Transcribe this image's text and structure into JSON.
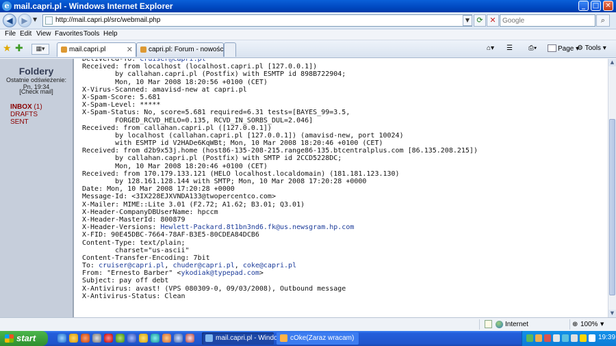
{
  "window": {
    "title": "mail.capri.pl - Windows Internet Explorer",
    "minimize": "_",
    "maximize": "□",
    "close": "✕"
  },
  "address_bar": {
    "url": "http://mail.capri.pl/src/webmail.php",
    "search_placeholder": "Google"
  },
  "menu": [
    "File",
    "Edit",
    "View",
    "Favorites",
    "Tools",
    "Help"
  ],
  "tabs": [
    {
      "label": "mail.capri.pl",
      "active": true
    },
    {
      "label": "capri.pl: Forum - nowości",
      "active": false
    }
  ],
  "command_bar": {
    "page": "Page",
    "tools": "Tools"
  },
  "sidebar": {
    "heading": "Foldery",
    "last_refresh_label": "Ostatnie odświeżenie:",
    "last_refresh_time": "Pn, 19:34",
    "check_mail": "[Check mail]",
    "folders": [
      {
        "name": "INBOX",
        "count": "(1)"
      },
      {
        "name": "DRAFTS",
        "count": ""
      },
      {
        "name": "SENT",
        "count": ""
      }
    ]
  },
  "headers": [
    {
      "text": "Delivered-To: ",
      "link": "cruiser@capri.pl",
      "tail": ""
    },
    {
      "text": "Received: from localhost (localhost.capri.pl [127.0.0.1])"
    },
    {
      "text": "        by callahan.capri.pl (Postfix) with ESMTP id 898B722904;"
    },
    {
      "text": "        Mon, 10 Mar 2008 18:20:56 +0100 (CET)"
    },
    {
      "text": "X-Virus-Scanned: amavisd-new at capri.pl"
    },
    {
      "text": "X-Spam-Score: 5.681"
    },
    {
      "text": "X-Spam-Level: *****"
    },
    {
      "text": "X-Spam-Status: No, score=5.681 required=6.31 tests=[BAYES_99=3.5,"
    },
    {
      "text": "        FORGED_RCVD_HELO=0.135, RCVD_IN_SORBS_DUL=2.046]"
    },
    {
      "text": "Received: from callahan.capri.pl ([127.0.0.1])"
    },
    {
      "text": "        by localhost (callahan.capri.pl [127.0.0.1]) (amavisd-new, port 10024)"
    },
    {
      "text": "        with ESMTP id V2HADe6KqWBt; Mon, 10 Mar 2008 18:20:46 +0100 (CET)"
    },
    {
      "text": "Received: from d2b9x53j.home (host86-135-208-215.range86-135.btcentralplus.com [86.135.208.215])"
    },
    {
      "text": "        by callahan.capri.pl (Postfix) with SMTP id 2CCD5228DC;"
    },
    {
      "text": "        Mon, 10 Mar 2008 18:20:46 +0100 (CET)"
    },
    {
      "text": "Received: from 170.179.133.121 (HELO localhost.localdomain) (181.181.123.130)"
    },
    {
      "text": "        by 128.161.128.144 with SMTP; Mon, 10 Mar 2008 17:20:28 +0000"
    },
    {
      "text": "Date: Mon, 10 Mar 2008 17:20:28 +0000"
    },
    {
      "text": "Message-Id: <3IX228EJXVNDA133@twopercentco.com>"
    },
    {
      "text": "X-Mailer: MIME::Lite 3.01 (F2.72; A1.62; B3.01; Q3.01)"
    },
    {
      "text": "X-Header-CompanyDBUserName: hpccm"
    },
    {
      "text": "X-Header-MasterId: 800879"
    },
    {
      "text": "X-Header-Versions: ",
      "link": "Hewlett-Packard.8t1bn3nd6.fk@us.newsgram.hp.com",
      "tail": ""
    },
    {
      "text": "X-FID: 90E45DBC-7664-78AF-B3E5-80CDEA84DCB6"
    },
    {
      "text": "Content-Type: text/plain;"
    },
    {
      "text": "        charset=\"us-ascii\""
    },
    {
      "text": "Content-Transfer-Encoding: 7bit"
    },
    {
      "text": "To: ",
      "links": [
        "cruiser@capri.pl",
        "chuder@capri.pl",
        "coke@capri.pl"
      ]
    },
    {
      "text": "From: \"Ernesto Barber\" <",
      "link": "ykodiak@typepad.com",
      "tail": ">"
    },
    {
      "text": "Subject: pay off debt"
    },
    {
      "text": "X-Antivirus: avast! (VPS 080309-0, 09/03/2008), Outbound message"
    },
    {
      "text": "X-Antivirus-Status: Clean"
    }
  ],
  "status_bar": {
    "zone": "Internet",
    "zoom": "100%"
  },
  "taskbar": {
    "start": "start",
    "items": [
      {
        "label": "mail.capri.pl - Windo...",
        "active": true
      },
      {
        "label": "cOke(Zaraz wracam)",
        "active": false
      }
    ],
    "clock": "19:39"
  }
}
